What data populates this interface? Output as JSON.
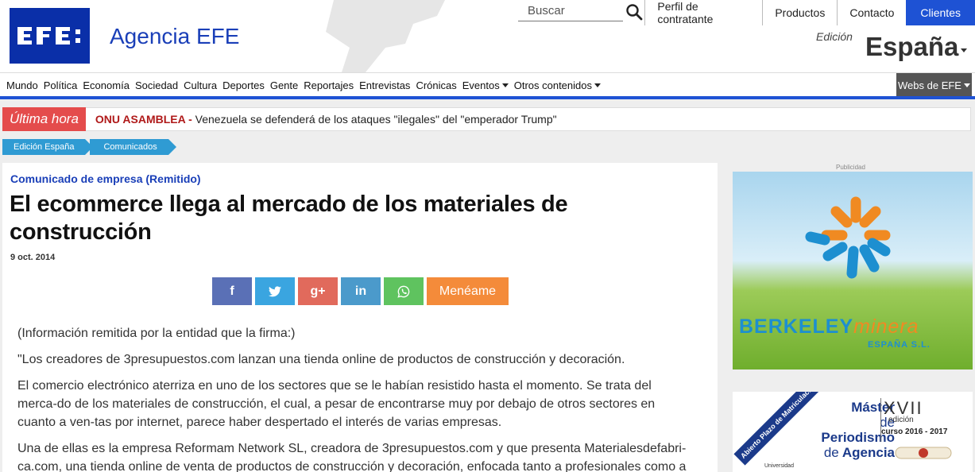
{
  "header": {
    "brand": "Agencia EFE",
    "logo_text": "EFE:",
    "search_placeholder": "Buscar",
    "utility_links": [
      "Perfil de contratante",
      "Productos",
      "Contacto"
    ],
    "clientes": "Clientes",
    "edicion_label": "Edición",
    "edicion_value": "España"
  },
  "nav": {
    "items": [
      "Mundo",
      "Política",
      "Economía",
      "Sociedad",
      "Cultura",
      "Deportes",
      "Gente",
      "Reportajes",
      "Entrevistas",
      "Crónicas"
    ],
    "eventos": "Eventos",
    "otros": "Otros contenidos",
    "webs": "Webs de EFE"
  },
  "breaking": {
    "label": "Última hora",
    "tag": "ONU ASAMBLEA -",
    "text": "Venezuela se defenderá de los ataques \"ilegales\" del \"emperador Trump\""
  },
  "breadcrumb": [
    "Edición España",
    "Comunicados"
  ],
  "article": {
    "kicker": "Comunicado de empresa (Remitido)",
    "title": "El ecommerce llega al mercado de los materiales de construcción",
    "date": "9 oct. 2014",
    "share": {
      "facebook": "f",
      "twitter": "t",
      "googleplus": "g+",
      "linkedin": "in",
      "whatsapp": "w",
      "meneame": "Menéame"
    },
    "paragraphs": [
      "(Información remitida por la entidad que la firma:)",
      "\"Los creadores de 3presupuestos.com lanzan una tienda online de productos de construcción y decoración.",
      "El comercio electrónico aterriza en uno de los sectores que se le habían resistido hasta el momento. Se trata del merca-do de los materiales de construcción, el cual, a pesar de encontrarse muy por debajo de otros sectores en cuanto a ven-tas por internet, parece haber despertado el interés de varias empresas.",
      "Una de ellas es la empresa Reformam Network SL, creadora de 3presupuestos.com y que presenta Materialesdefabri-ca.com, una tienda online de venta de productos de construcción y decoración, enfocada tanto a profesionales como a"
    ]
  },
  "sidebar": {
    "publicidad": "Publicidad",
    "ad1": {
      "name_a": "BERKELEY",
      "name_b": "minera",
      "sub": "ESPAÑA S.L."
    },
    "ad2": {
      "ribbon": "Abierto Plazo de Matriculación",
      "master": "Máster",
      "de": "de",
      "periodismo": "Periodismo",
      "de2": "de",
      "agencia": "Agencia",
      "xvii": "XVII",
      "edicion": "edición",
      "curso": "curso 2016 - 2017",
      "univ": "Universidad"
    }
  },
  "colors": {
    "efe_blue": "#0a2fa8",
    "accent_blue": "#1e52d4",
    "breaking_red": "#e44c4c",
    "crumb_blue": "#2f9bd3"
  }
}
